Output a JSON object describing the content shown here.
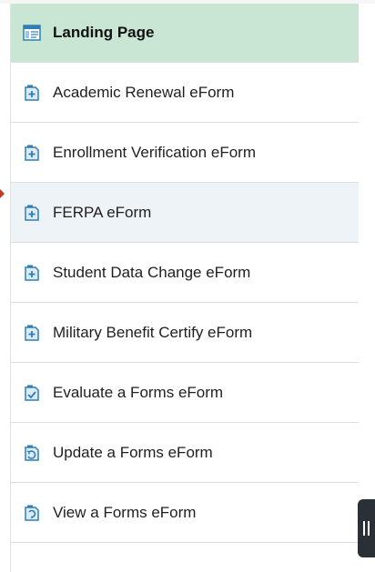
{
  "nav": {
    "items": [
      {
        "label": "Landing Page",
        "icon": "landing-page-icon",
        "active": true
      },
      {
        "label": "Academic Renewal eForm",
        "icon": "add-form-icon"
      },
      {
        "label": "Enrollment Verification eForm",
        "icon": "add-form-icon"
      },
      {
        "label": "FERPA eForm",
        "icon": "add-form-icon"
      },
      {
        "label": "Student Data Change eForm",
        "icon": "add-form-icon"
      },
      {
        "label": "Military Benefit Certify eForm",
        "icon": "add-form-icon"
      },
      {
        "label": "Evaluate a Forms eForm",
        "icon": "evaluate-form-icon"
      },
      {
        "label": "Update a Forms eForm",
        "icon": "update-form-icon"
      },
      {
        "label": "View a Forms eForm",
        "icon": "view-form-icon"
      }
    ]
  },
  "colors": {
    "active_bg": "#c8e6d3",
    "icon_blue": "#2f7fb5",
    "handle_bg": "#2b2f36"
  }
}
